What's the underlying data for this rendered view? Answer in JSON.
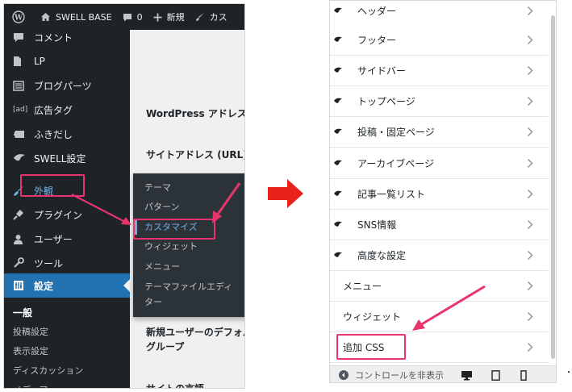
{
  "colors": {
    "admin_dark": "#1d2327",
    "flyout_bg": "#2c3338",
    "active_blue": "#2271b1",
    "link_blue": "#72aee6",
    "highlight_pink": "#e8336d",
    "arrow_red": "#e8231c"
  },
  "left": {
    "adminbar": {
      "items": [
        "SWELL BASE",
        "0",
        "新規",
        "カス"
      ]
    },
    "sidebar": {
      "items": [
        {
          "label": "コメント",
          "icon": "comment-icon"
        },
        {
          "label": "LP",
          "icon": "document-icon"
        },
        {
          "label": "ブログパーツ",
          "icon": "blog-parts-icon"
        },
        {
          "label": "広告タグ",
          "icon": "ad-icon",
          "icon_text": "[ad]"
        },
        {
          "label": "ふきだし",
          "icon": "balloon-icon"
        },
        {
          "label": "SWELL設定",
          "icon": "swell-icon"
        },
        {
          "label": "外観",
          "icon": "brush-icon"
        },
        {
          "label": "プラグイン",
          "icon": "plugin-icon"
        },
        {
          "label": "ユーザー",
          "icon": "user-icon"
        },
        {
          "label": "ツール",
          "icon": "wrench-icon"
        },
        {
          "label": "設定",
          "icon": "settings-icon"
        }
      ],
      "submenu": [
        "一般",
        "投稿設定",
        "表示設定",
        "ディスカッション",
        "メディア"
      ]
    },
    "content": {
      "labels": [
        "WordPress アドレス (URL)",
        "サイトアドレス (URL)",
        "新規ユーザーのデフォルト",
        "グループ",
        "サイトの言語"
      ]
    },
    "flyout": {
      "items": [
        "テーマ",
        "パターン",
        "カスタマイズ",
        "ウィジェット",
        "メニュー",
        "テーマファイルエディ",
        "ター"
      ]
    }
  },
  "right": {
    "items": [
      {
        "label": "ヘッダー",
        "swell": true
      },
      {
        "label": "フッター",
        "swell": true
      },
      {
        "label": "サイドバー",
        "swell": true
      },
      {
        "label": "トップページ",
        "swell": true
      },
      {
        "label": "投稿・固定ページ",
        "swell": true
      },
      {
        "label": "アーカイブページ",
        "swell": true
      },
      {
        "label": "記事一覧リスト",
        "swell": true
      },
      {
        "label": "SNS情報",
        "swell": true
      },
      {
        "label": "高度な設定",
        "swell": true
      },
      {
        "label": "メニュー",
        "swell": false
      },
      {
        "label": "ウィジェット",
        "swell": false
      },
      {
        "label": "追加 CSS",
        "swell": false
      }
    ],
    "footer": {
      "hide_controls": "コントロールを非表示"
    }
  }
}
